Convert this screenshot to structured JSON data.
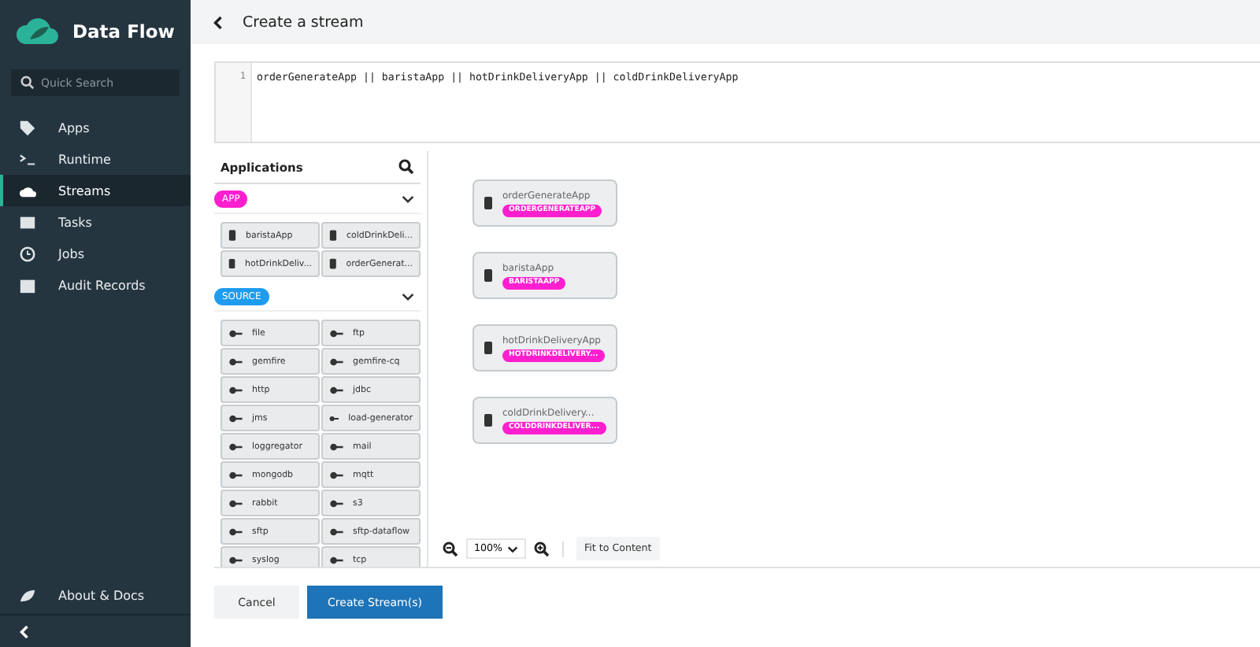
{
  "sidebar": {
    "brand": "Data Flow",
    "search": {
      "placeholder": "Quick Search"
    },
    "items": [
      {
        "label": "Apps",
        "selected": false
      },
      {
        "label": "Runtime",
        "selected": false
      },
      {
        "label": "Streams",
        "selected": true
      },
      {
        "label": "Tasks",
        "selected": false
      },
      {
        "label": "Jobs",
        "selected": false
      },
      {
        "label": "Audit Records",
        "selected": false
      }
    ],
    "footer_item": "About & Docs"
  },
  "header": {
    "title": "Create a stream"
  },
  "editor": {
    "lines": [
      {
        "number": "1",
        "text": "orderGenerateApp || baristaApp || hotDrinkDeliveryApp || coldDrinkDeliveryApp"
      }
    ]
  },
  "palette": {
    "title": "Applications",
    "groups": [
      {
        "label": "APP",
        "color": "#ff1fcf",
        "expanded": true,
        "kind": "processor",
        "items": [
          "baristaApp",
          "coldDrinkDeli...",
          "hotDrinkDeliv...",
          "orderGenerat..."
        ]
      },
      {
        "label": "SOURCE",
        "color": "#1e9cf0",
        "expanded": true,
        "kind": "source",
        "items": [
          "file",
          "ftp",
          "gemfire",
          "gemfire-cq",
          "http",
          "jdbc",
          "jms",
          "load-generator",
          "loggregator",
          "mail",
          "mongodb",
          "mqtt",
          "rabbit",
          "s3",
          "sftp",
          "sftp-dataflow",
          "syslog",
          "tcp"
        ]
      }
    ]
  },
  "canvas": {
    "nodes": [
      {
        "name": "orderGenerateApp",
        "tag": "ORDERGENERATEAPP"
      },
      {
        "name": "baristaApp",
        "tag": "BARISTAAPP"
      },
      {
        "name": "hotDrinkDeliveryApp",
        "tag": "HOTDRINKDELIVERY..."
      },
      {
        "name": "coldDrinkDelivery...",
        "tag": "COLDDRINKDELIVER..."
      }
    ],
    "zoom": "100%",
    "fit_button": "Fit to Content"
  },
  "buttons": [
    {
      "label": "Cancel",
      "kind": "secondary"
    },
    {
      "label": "Create Stream(s)",
      "kind": "primary"
    }
  ]
}
